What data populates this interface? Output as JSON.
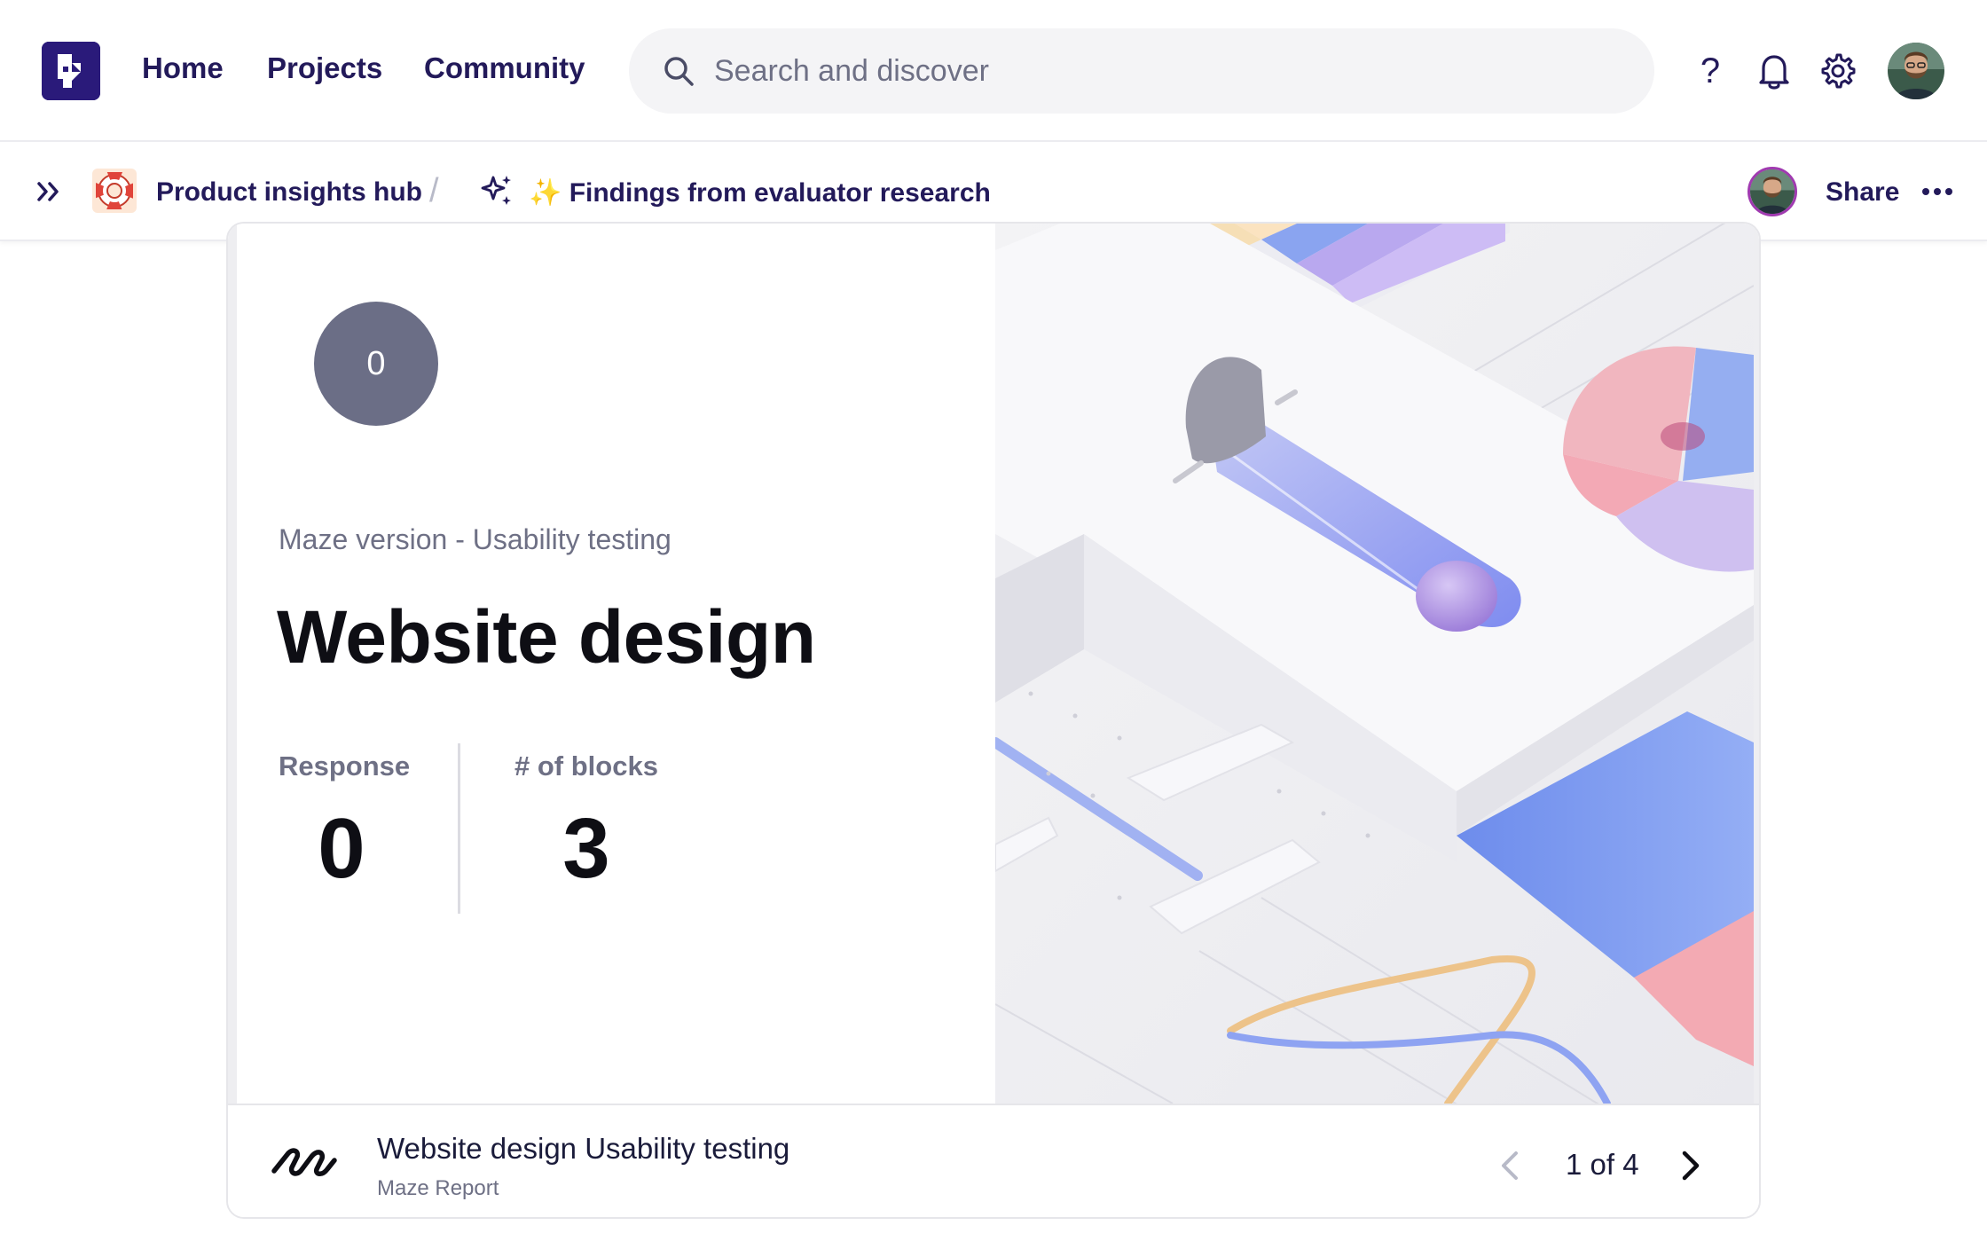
{
  "nav": {
    "links": [
      "Home",
      "Projects",
      "Community"
    ],
    "search_placeholder": "Search and discover",
    "help": "?"
  },
  "breadcrumb": {
    "hub": "Product insights hub",
    "separator": "/",
    "page": "✨ Findings from evaluator research",
    "share": "Share"
  },
  "card": {
    "badge": "0",
    "subtitle": "Maze version - Usability testing",
    "title": "Website design",
    "stats": [
      {
        "label": "Response",
        "value": "0"
      },
      {
        "label": "# of blocks",
        "value": "3"
      }
    ],
    "footer": {
      "title": "Website design Usability testing",
      "subtitle": "Maze Report",
      "pager": "1 of 4"
    }
  },
  "colors": {
    "brand": "#2a1a7a",
    "nav_text": "#231a5a",
    "muted": "#6e7085",
    "badge_bg": "#6b6e86"
  },
  "icons": [
    "logo-icon",
    "search-icon",
    "help-icon",
    "bell-icon",
    "gear-icon",
    "expand-icon",
    "lifebuoy-icon",
    "sparkles-icon",
    "more-icon",
    "maze-logo-icon",
    "chevron-left-icon",
    "chevron-right-icon"
  ]
}
